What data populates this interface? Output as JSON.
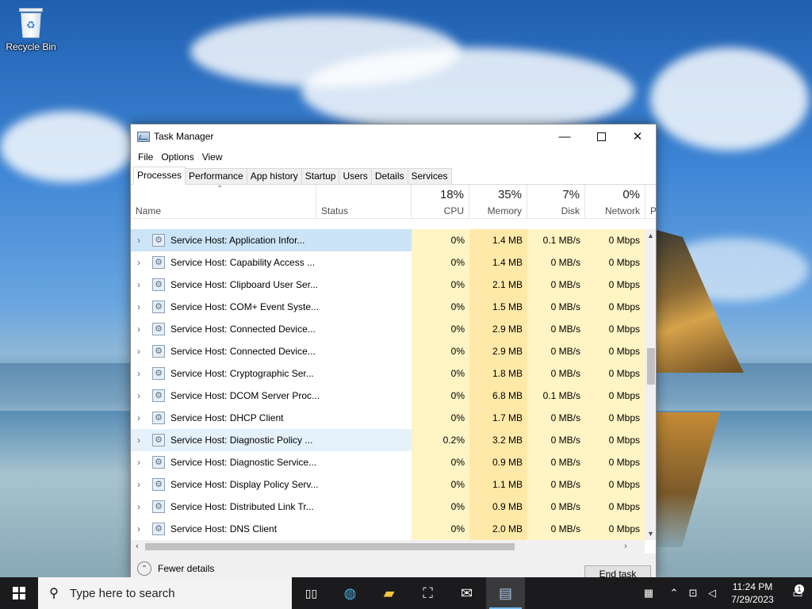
{
  "desktop": {
    "icon_label": "Recycle Bin"
  },
  "window": {
    "title": "Task Manager",
    "menu": [
      "File",
      "Options",
      "View"
    ],
    "tabs": [
      "Processes",
      "Performance",
      "App history",
      "Startup",
      "Users",
      "Details",
      "Services"
    ],
    "active_tab": "Processes",
    "columns": {
      "name": "Name",
      "status": "Status",
      "cpu": {
        "pct": "18%",
        "label": "CPU"
      },
      "memory": {
        "pct": "35%",
        "label": "Memory"
      },
      "disk": {
        "pct": "7%",
        "label": "Disk"
      },
      "network": {
        "pct": "0%",
        "label": "Network"
      },
      "power_partial": "P"
    },
    "processes": [
      {
        "name": "Service Host: Application Infor...",
        "cpu": "0%",
        "memory": "1.4 MB",
        "disk": "0.1 MB/s",
        "network": "0 Mbps"
      },
      {
        "name": "Service Host: Capability Access ...",
        "cpu": "0%",
        "memory": "1.4 MB",
        "disk": "0 MB/s",
        "network": "0 Mbps"
      },
      {
        "name": "Service Host: Clipboard User Ser...",
        "cpu": "0%",
        "memory": "2.1 MB",
        "disk": "0 MB/s",
        "network": "0 Mbps"
      },
      {
        "name": "Service Host: COM+ Event Syste...",
        "cpu": "0%",
        "memory": "1.5 MB",
        "disk": "0 MB/s",
        "network": "0 Mbps"
      },
      {
        "name": "Service Host: Connected Device...",
        "cpu": "0%",
        "memory": "2.9 MB",
        "disk": "0 MB/s",
        "network": "0 Mbps"
      },
      {
        "name": "Service Host: Connected Device...",
        "cpu": "0%",
        "memory": "2.9 MB",
        "disk": "0 MB/s",
        "network": "0 Mbps"
      },
      {
        "name": "Service Host: Cryptographic Ser...",
        "cpu": "0%",
        "memory": "1.8 MB",
        "disk": "0 MB/s",
        "network": "0 Mbps"
      },
      {
        "name": "Service Host: DCOM Server Proc...",
        "cpu": "0%",
        "memory": "6.8 MB",
        "disk": "0.1 MB/s",
        "network": "0 Mbps"
      },
      {
        "name": "Service Host: DHCP Client",
        "cpu": "0%",
        "memory": "1.7 MB",
        "disk": "0 MB/s",
        "network": "0 Mbps"
      },
      {
        "name": "Service Host: Diagnostic Policy ...",
        "cpu": "0.2%",
        "memory": "3.2 MB",
        "disk": "0 MB/s",
        "network": "0 Mbps"
      },
      {
        "name": "Service Host: Diagnostic Service...",
        "cpu": "0%",
        "memory": "0.9 MB",
        "disk": "0 MB/s",
        "network": "0 Mbps"
      },
      {
        "name": "Service Host: Display Policy Serv...",
        "cpu": "0%",
        "memory": "1.1 MB",
        "disk": "0 MB/s",
        "network": "0 Mbps"
      },
      {
        "name": "Service Host: Distributed Link Tr...",
        "cpu": "0%",
        "memory": "0.9 MB",
        "disk": "0 MB/s",
        "network": "0 Mbps"
      },
      {
        "name": "Service Host: DNS Client",
        "cpu": "0%",
        "memory": "2.0 MB",
        "disk": "0 MB/s",
        "network": "0 Mbps"
      }
    ],
    "footer": {
      "fewer_details": "Fewer details",
      "end_task": "End task"
    }
  },
  "taskbar": {
    "search_placeholder": "Type here to search",
    "clock_time": "11:24 PM",
    "clock_date": "7/29/2023",
    "notification_count": "1"
  }
}
